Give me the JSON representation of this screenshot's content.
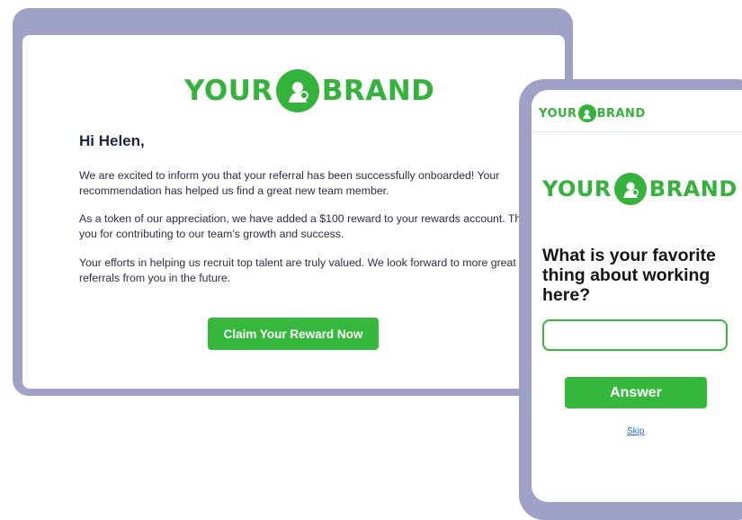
{
  "brand": {
    "left": "YOUR",
    "right": "BRAND",
    "color": "#33b339"
  },
  "email": {
    "greeting": "Hi Helen,",
    "paragraphs": [
      "We are excited to inform you that your referral has been successfully onboarded! Your recommendation has helped us find a great new team member.",
      "As a token of our appreciation, we have added a $100 reward to your rewards account. Thank you for contributing to our team’s growth and success.",
      "Your efforts in helping us recruit top talent are truly valued. We look forward to more great referrals from you in the future."
    ],
    "cta_label": "Claim Your Reward  Now"
  },
  "phone": {
    "question": "What is your favorite thing about working here?",
    "answer_value": "",
    "answer_button_label": "Answer",
    "skip_label": "Skip"
  },
  "colors": {
    "frame": "#9fa2c6",
    "accent": "#35b83b",
    "link": "#2a6fd8"
  }
}
